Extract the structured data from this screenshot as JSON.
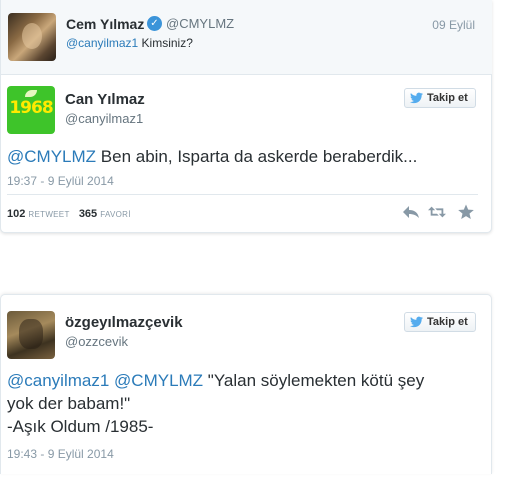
{
  "tweet1": {
    "parent": {
      "name": "Cem Yılmaz",
      "handle": "@CMYLMZ",
      "date": "09 Eylül",
      "mention": "@canyilmaz1",
      "text": " Kimsiniz?"
    },
    "author": {
      "name": "Can Yılmaz",
      "handle": "@canyilmaz1",
      "avatar_text": "1968"
    },
    "follow_label": "Takip et",
    "mention": "@CMYLMZ",
    "text": " Ben abin, Isparta da askerde beraberdik...",
    "timestamp": "19:37 - 9 Eylül 2014",
    "retweet_count": "102",
    "retweet_label": "RETWEET",
    "favorite_count": "365",
    "favorite_label": "FAVORİ"
  },
  "tweet2": {
    "author": {
      "name": "özgeyılmazçevik",
      "handle": "@ozzcevik"
    },
    "follow_label": "Takip et",
    "mention1": "@canyilmaz1",
    "mention2": "@CMYLMZ",
    "text_line1": " \"Yalan söylemekten kötü şey",
    "text_line2": "yok der babam!\"",
    "text_line3": "-Aşık Oldum /1985-",
    "timestamp": "19:43 - 9 Eylül 2014"
  },
  "colors": {
    "link": "#2b7bb9",
    "verified": "#3b94d9",
    "muted": "#8899a6",
    "twitter_blue": "#55acee"
  },
  "icons": [
    "verified-badge-icon",
    "twitter-bird-icon",
    "reply-icon",
    "retweet-icon",
    "favorite-star-icon"
  ]
}
